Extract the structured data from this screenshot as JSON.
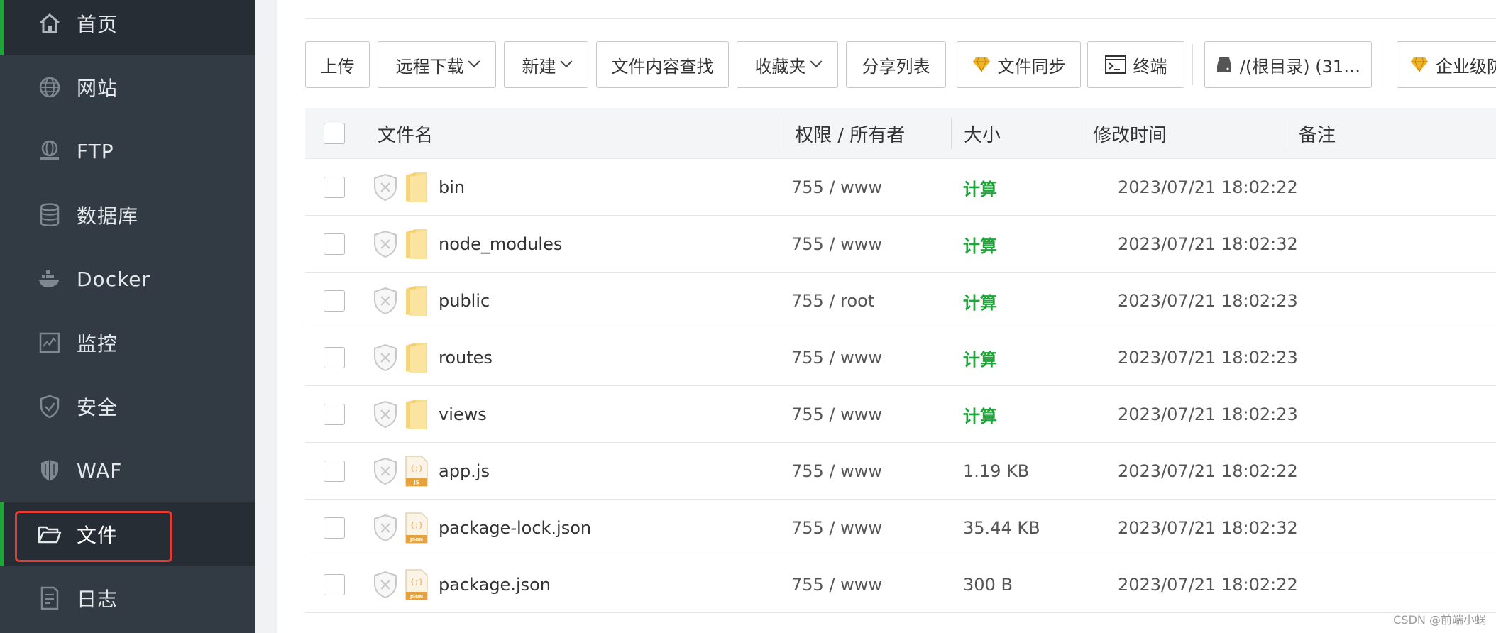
{
  "sidebar": {
    "items": [
      {
        "label": "首页",
        "icon": "home-icon"
      },
      {
        "label": "网站",
        "icon": "globe-icon"
      },
      {
        "label": "FTP",
        "icon": "ftp-server-icon"
      },
      {
        "label": "数据库",
        "icon": "database-icon"
      },
      {
        "label": "Docker",
        "icon": "docker-icon"
      },
      {
        "label": "监控",
        "icon": "monitor-chart-icon"
      },
      {
        "label": "安全",
        "icon": "shield-check-icon"
      },
      {
        "label": "WAF",
        "icon": "waf-shield-icon"
      },
      {
        "label": "文件",
        "icon": "folder-open-icon"
      },
      {
        "label": "日志",
        "icon": "log-document-icon"
      }
    ],
    "active_index": 8
  },
  "toolbar": {
    "upload": "上传",
    "remote_download": "远程下载",
    "new": "新建",
    "content_search": "文件内容查找",
    "favorites": "收藏夹",
    "share_list": "分享列表",
    "file_sync": "文件同步",
    "terminal": "终端",
    "disk": "/(根目录) (31…",
    "enterprise": "企业级防"
  },
  "colors": {
    "accent_green": "#20a53a",
    "highlight_red": "#e83a33",
    "sidebar_bg": "#323a43",
    "diamond_gold": "#f0b428"
  },
  "table": {
    "headers": {
      "name": "文件名",
      "perm": "权限 / 所有者",
      "size": "大小",
      "mtime": "修改时间",
      "note": "备注"
    },
    "rows": [
      {
        "name": "bin",
        "type": "folder",
        "perm": "755 / www",
        "size": "计算",
        "mtime": "2023/07/21 18:02:22"
      },
      {
        "name": "node_modules",
        "type": "folder",
        "perm": "755 / www",
        "size": "计算",
        "mtime": "2023/07/21 18:02:32"
      },
      {
        "name": "public",
        "type": "folder",
        "perm": "755 / root",
        "size": "计算",
        "mtime": "2023/07/21 18:02:23"
      },
      {
        "name": "routes",
        "type": "folder",
        "perm": "755 / www",
        "size": "计算",
        "mtime": "2023/07/21 18:02:23"
      },
      {
        "name": "views",
        "type": "folder",
        "perm": "755 / www",
        "size": "计算",
        "mtime": "2023/07/21 18:02:23"
      },
      {
        "name": "app.js",
        "type": "js",
        "perm": "755 / www",
        "size": "1.19 KB",
        "mtime": "2023/07/21 18:02:22"
      },
      {
        "name": "package-lock.json",
        "type": "json",
        "perm": "755 / www",
        "size": "35.44 KB",
        "mtime": "2023/07/21 18:02:32"
      },
      {
        "name": "package.json",
        "type": "json",
        "perm": "755 / www",
        "size": "300 B",
        "mtime": "2023/07/21 18:02:22"
      }
    ]
  },
  "watermark": "CSDN @前端小蜗",
  "file_icon_labels": {
    "js": "JS",
    "json": "JSON",
    "code": "{;}"
  }
}
